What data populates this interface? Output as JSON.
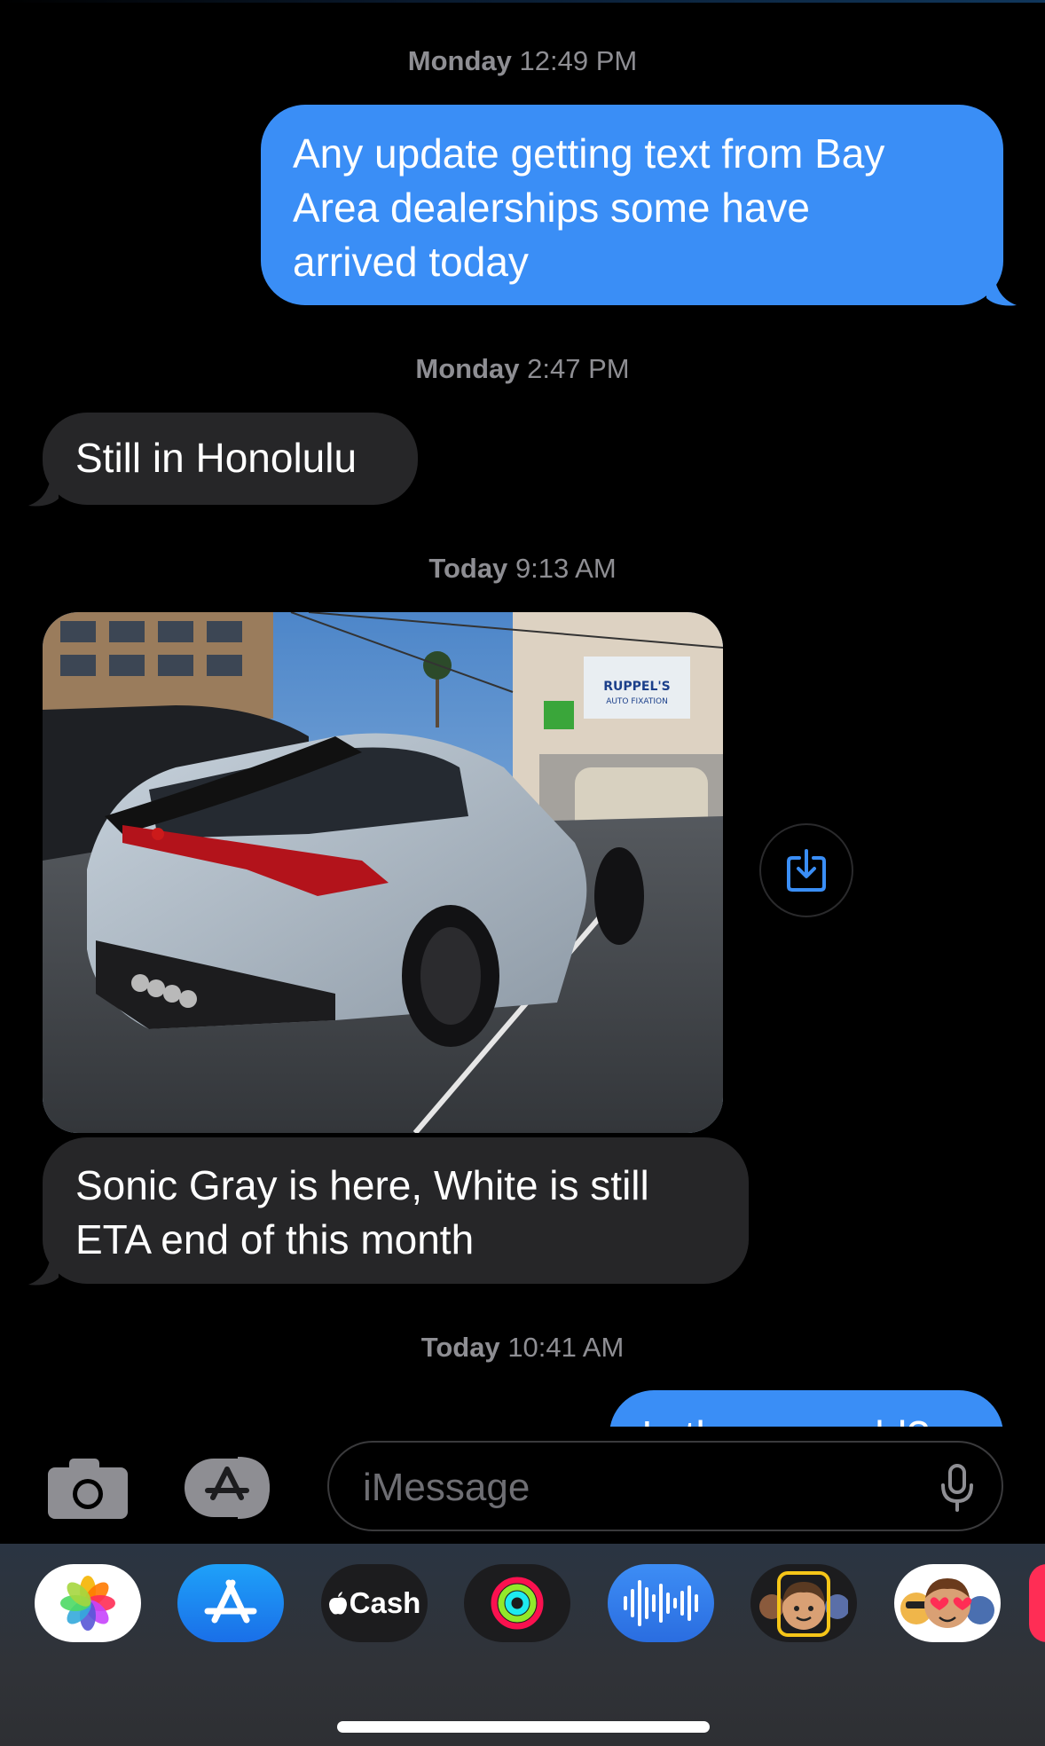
{
  "timestamps": [
    {
      "day": "Monday",
      "time": "12:49 PM"
    },
    {
      "day": "Monday",
      "time": "2:47 PM"
    },
    {
      "day": "Today",
      "time": "9:13 AM"
    },
    {
      "day": "Today",
      "time": "10:41 AM"
    }
  ],
  "messages": [
    {
      "direction": "outgoing",
      "lines": [
        "Any update getting text from Bay",
        "Area dealerships some have",
        "arrived today"
      ]
    },
    {
      "direction": "incoming",
      "lines": [
        "Still in Honolulu"
      ]
    },
    {
      "direction": "incoming",
      "type": "photo",
      "sign_text": [
        "RUPPEL'S",
        "AUTO FIXATION"
      ]
    },
    {
      "direction": "incoming",
      "lines": [
        "Sonic Gray is here, White is still",
        "ETA end of this month"
      ]
    },
    {
      "direction": "outgoing",
      "lines": [
        "Is the one sold?"
      ]
    }
  ],
  "compose": {
    "placeholder": "iMessage"
  },
  "app_drawer": [
    {
      "name": "Photos",
      "icon": "photos-icon"
    },
    {
      "name": "App Store",
      "icon": "app-store-icon"
    },
    {
      "name": "Cash",
      "icon": "apple-cash-icon",
      "label": "Cash"
    },
    {
      "name": "Fitness",
      "icon": "activity-rings-icon"
    },
    {
      "name": "Audio",
      "icon": "audio-waveform-icon"
    },
    {
      "name": "Memoji",
      "icon": "memoji-icon"
    },
    {
      "name": "Stickers",
      "icon": "memoji-stickers-icon"
    }
  ],
  "colors": {
    "outgoing_bubble": "#3a8ef6",
    "incoming_bubble": "#262628",
    "timestamp": "#8e8e93",
    "background": "#000000"
  }
}
